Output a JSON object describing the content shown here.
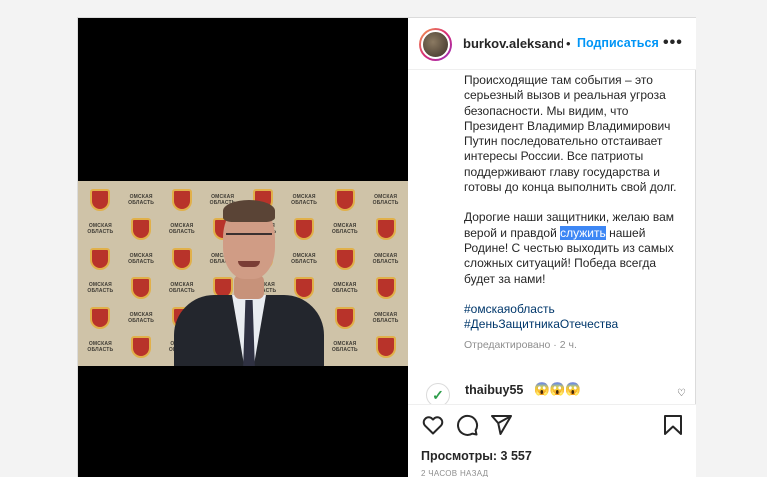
{
  "post": {
    "username": "burkov.aleksandr.le",
    "separator": "•",
    "follow_label": "Подписаться",
    "more_label": "•••",
    "caption": {
      "p1": "Происходящие там события – это серьезный вызов и реальная угроза безопасности. Мы видим, что Президент Владимир Владимирович Путин последовательно отстаивает интересы России. Все патриоты поддерживают главу государства и готовы до конца выполнить свой долг.",
      "p2_before": "Дорогие наши защитники, желаю вам верой и правдой ",
      "p2_highlight": "служить",
      "p2_after": " нашей Родине! С честью выходить из самых сложных ситуаций! Победа всегда будет за нами!",
      "tags": [
        "#омскаяобласть",
        "#ДеньЗащитникаОтечества"
      ],
      "edited": "Отредактировано · 2 ч."
    },
    "comment": {
      "avatar_icon": "✓",
      "user": "thaibuy55",
      "text": "😱😱😱",
      "like_icon": "♡"
    },
    "views": "Просмотры: 3 557",
    "time": "2 ЧАСОВ НАЗАД"
  },
  "video": {
    "backdrop_text": "ОМСКАЯ ОБЛАСТЬ"
  }
}
